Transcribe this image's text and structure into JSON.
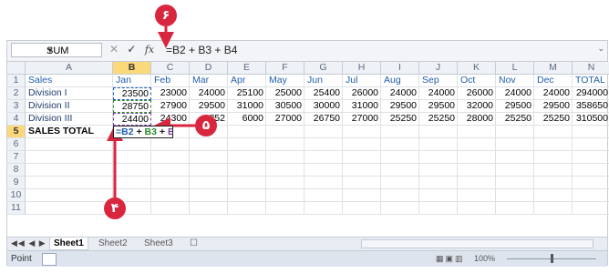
{
  "formula_bar": {
    "name_box": "SUM",
    "cancel_icon": "cancel-x-icon",
    "enter_icon": "enter-check-icon",
    "fx_label": "fx",
    "formula": "=B2 + B3 + B4"
  },
  "columns": [
    "A",
    "B",
    "C",
    "D",
    "E",
    "F",
    "G",
    "H",
    "I",
    "J",
    "K",
    "L",
    "M",
    "N"
  ],
  "row_numbers": [
    "1",
    "2",
    "3",
    "4",
    "5",
    "6",
    "7",
    "8",
    "9",
    "10",
    "11"
  ],
  "rows": [
    [
      "Sales",
      "Jan",
      "Feb",
      "Mar",
      "Apr",
      "May",
      "Jun",
      "Jul",
      "Aug",
      "Sep",
      "Oct",
      "Nov",
      "Dec",
      "TOTAL"
    ],
    [
      "Division I",
      "23500",
      "23000",
      "24000",
      "25100",
      "25000",
      "25400",
      "26000",
      "24000",
      "24000",
      "26000",
      "24000",
      "24000",
      "294000"
    ],
    [
      "Division II",
      "28750",
      "27900",
      "29500",
      "31000",
      "30500",
      "30000",
      "31000",
      "29500",
      "29500",
      "32000",
      "29500",
      "29500",
      "358650"
    ],
    [
      "Division III",
      "24400",
      "24300",
      "252",
      "6000",
      "27000",
      "26750",
      "27000",
      "25250",
      "25250",
      "28000",
      "25250",
      "25250",
      "310500"
    ],
    [
      "SALES TOTAL",
      "",
      "",
      "",
      "",
      "",
      "",
      "",
      "",
      "",
      "",
      "",
      "",
      ""
    ]
  ],
  "formula_cell": {
    "p1": "=B2",
    "p2": "B3",
    "p3": "B4",
    "plus": " + "
  },
  "sheet_tabs": [
    "Sheet1",
    "Sheet2",
    "Sheet3"
  ],
  "status": {
    "mode": "Point",
    "zoom": "100%"
  },
  "callouts": {
    "c4": "۴",
    "c5": "۵",
    "c6": "۶"
  },
  "colors": {
    "callout": "#d7263d",
    "ref_b2": "#1e5fb4",
    "ref_b3": "#2e8b2e",
    "ref_b4": "#7a3fa0",
    "selected_header": "#fbd97b"
  }
}
